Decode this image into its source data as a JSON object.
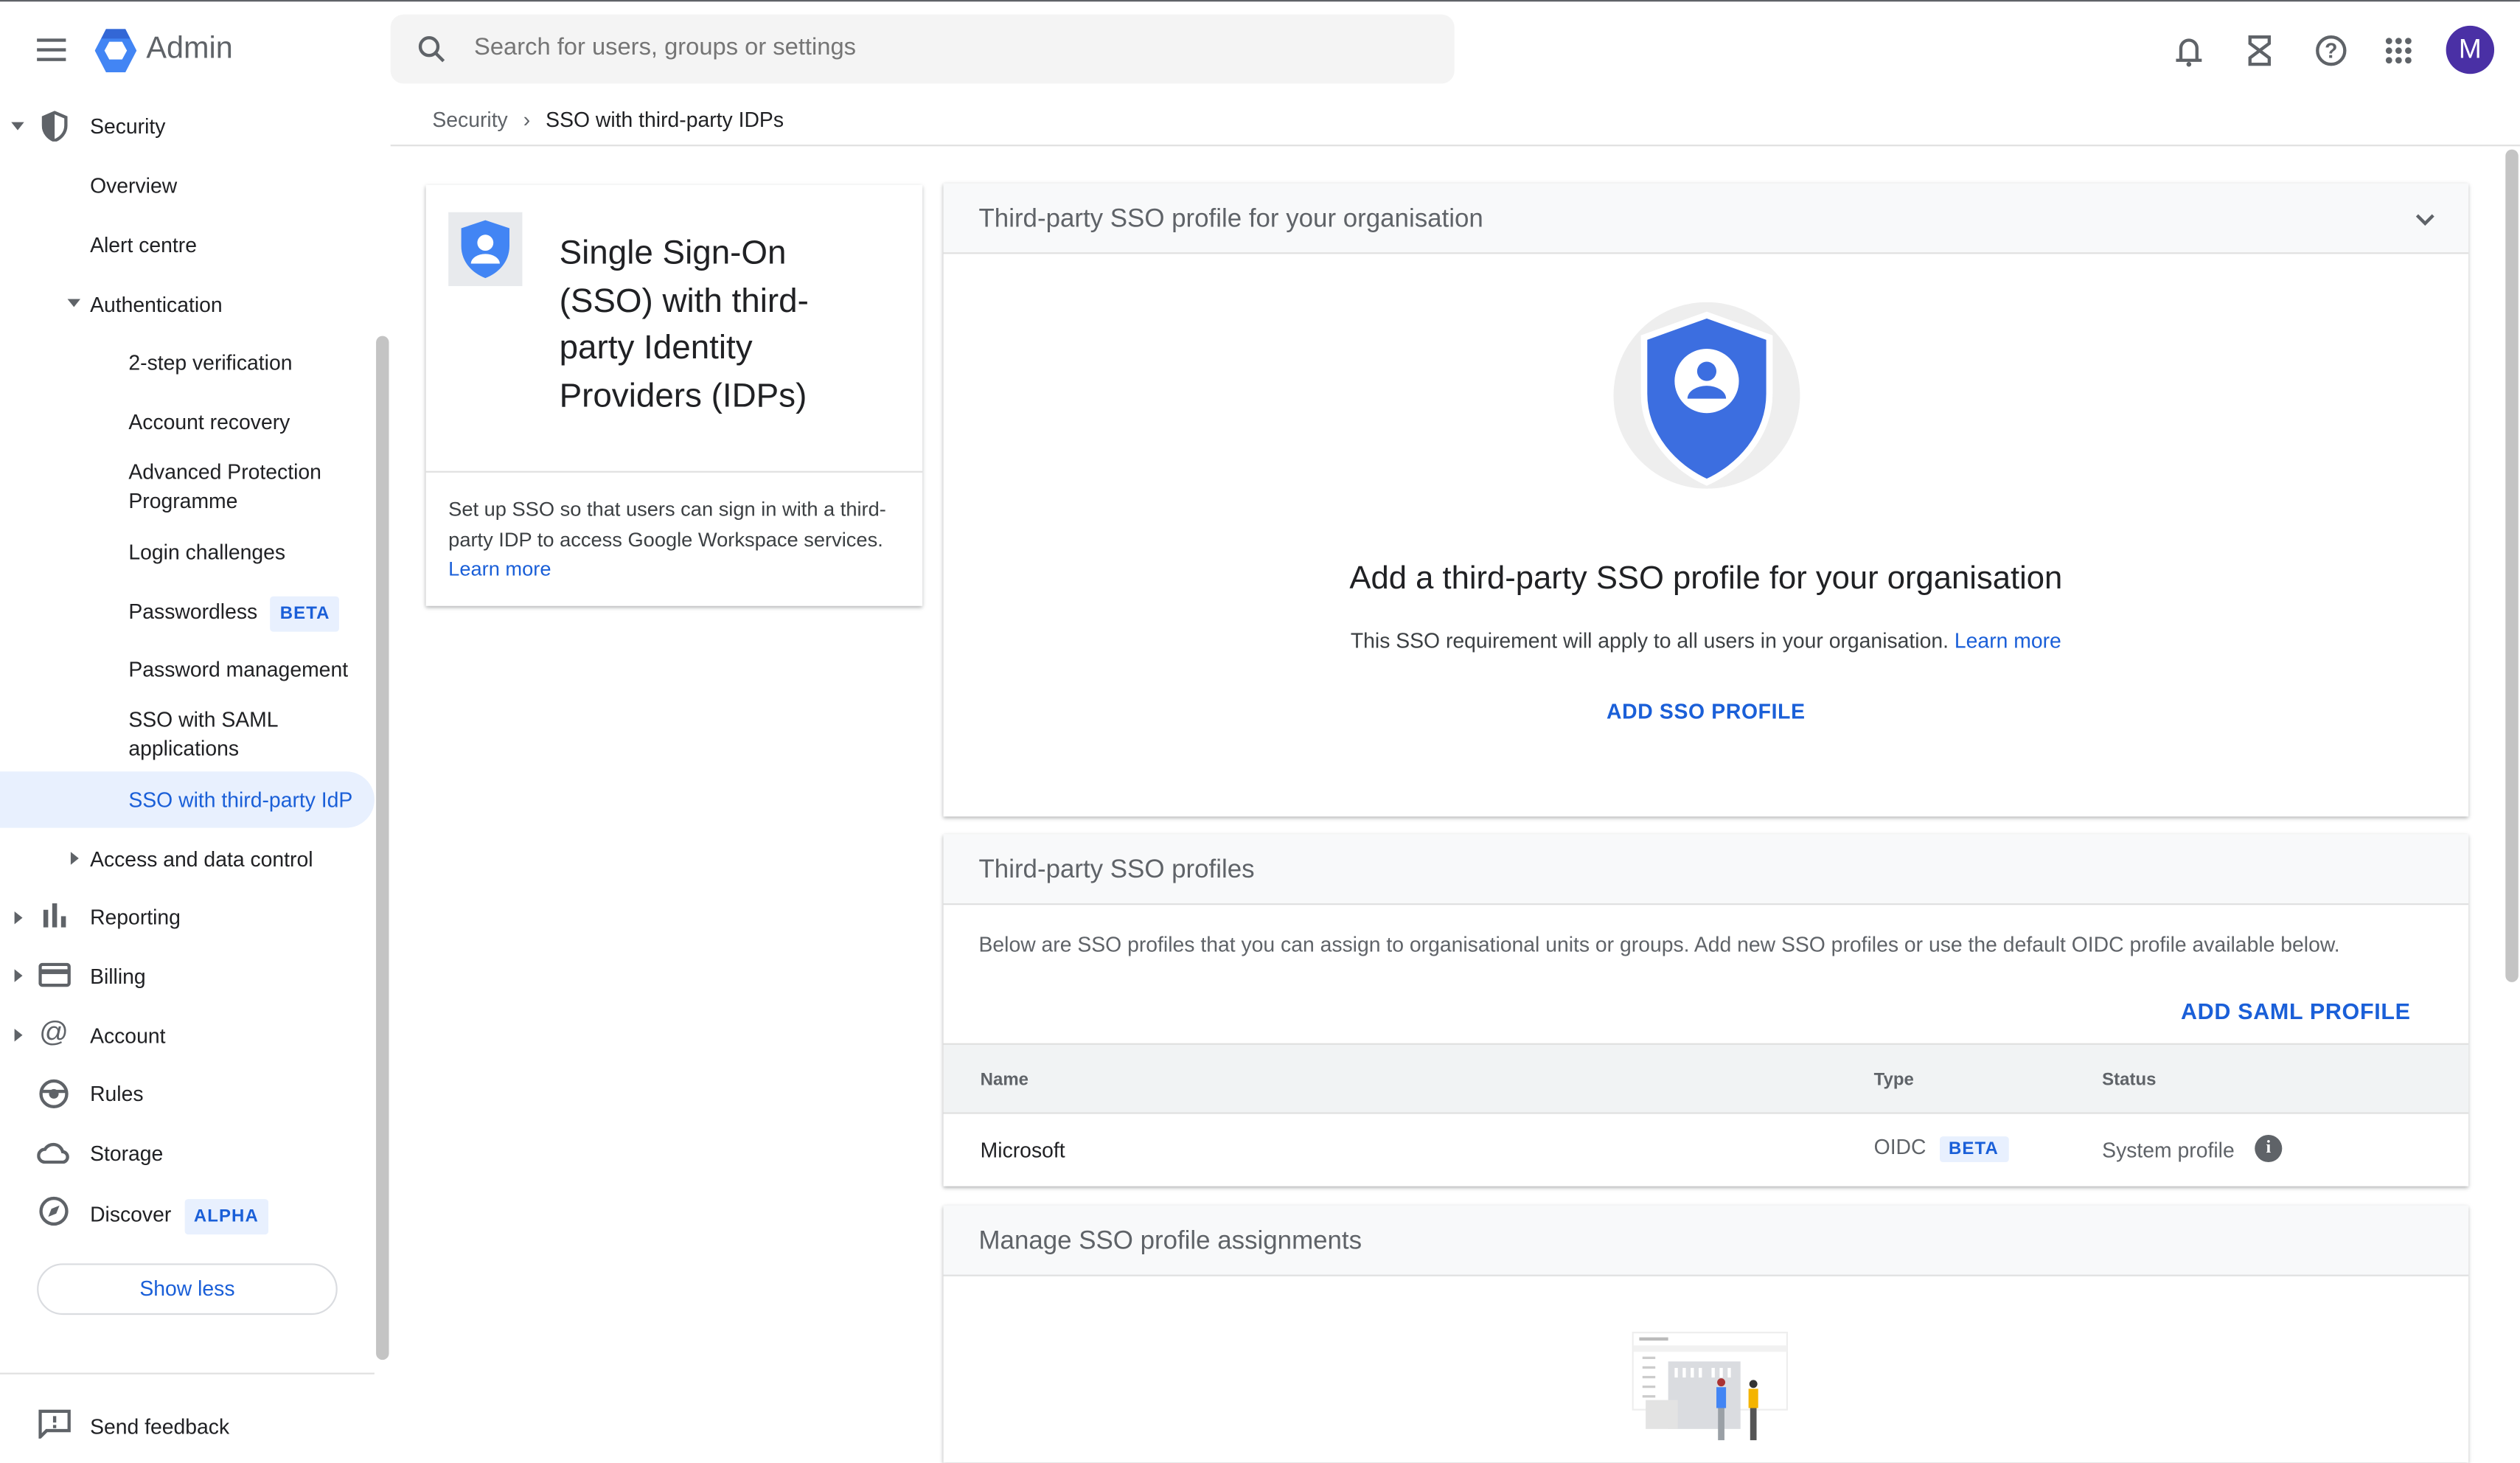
{
  "header": {
    "app_name": "Admin",
    "search_placeholder": "Search for users, groups or settings",
    "avatar_letter": "M",
    "avatar_color": "#4a30a5"
  },
  "breadcrumb": {
    "parent": "Security",
    "current": "SSO with third-party IDPs"
  },
  "sidebar": {
    "security": "Security",
    "overview": "Overview",
    "alert_centre": "Alert centre",
    "authentication": "Authentication",
    "auth_items": [
      "2-step verification",
      "Account recovery",
      "Advanced Protection Programme",
      "Login challenges",
      "Passwordless",
      "Password management",
      "SSO with SAML applications",
      "SSO with third-party IdP"
    ],
    "passwordless_badge": "BETA",
    "access": "Access and data control",
    "reporting": "Reporting",
    "billing": "Billing",
    "account": "Account",
    "rules": "Rules",
    "storage": "Storage",
    "discover": "Discover",
    "discover_badge": "ALPHA",
    "show_less": "Show less",
    "send_feedback": "Send feedback"
  },
  "info_card": {
    "title": "Single Sign-On (SSO) with third-party Identity Providers (IDPs)",
    "description": "Set up SSO so that users can sign in with a third-party IDP to access Google Workspace services.",
    "learn_more": "Learn more"
  },
  "org_profile": {
    "header": "Third-party SSO profile for your organisation",
    "heading": "Add a third-party SSO profile for your organisation",
    "description": "This SSO requirement will apply to all users in your organisation.",
    "learn_more": "Learn more",
    "button": "ADD SSO PROFILE"
  },
  "profiles": {
    "header": "Third-party SSO profiles",
    "description": "Below are SSO profiles that you can assign to organisational units or groups. Add new SSO profiles or use the default OIDC profile available below.",
    "button": "ADD SAML PROFILE",
    "columns": [
      "Name",
      "Type",
      "Status"
    ],
    "rows": [
      {
        "name": "Microsoft",
        "type": "OIDC",
        "type_badge": "BETA",
        "status": "System profile"
      }
    ]
  },
  "assignments": {
    "header": "Manage SSO profile assignments"
  },
  "colors": {
    "accent": "#1a5fd8",
    "selected_bg": "#e8f0fe"
  }
}
